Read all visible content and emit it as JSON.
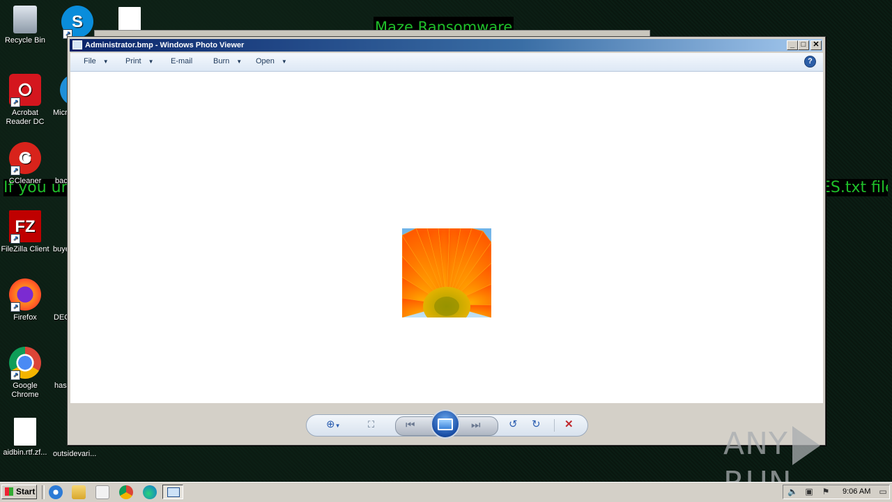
{
  "wallpaper": {
    "title_text": "Maze Ransomware",
    "line_left": "If you und",
    "line_right": "ES.txt file"
  },
  "desktop_icons": [
    {
      "label": "Recycle Bin",
      "icon": "recycle-bin-icon"
    },
    {
      "label": "Acrobat Reader DC",
      "icon": "acrobat-icon"
    },
    {
      "label": "CCleaner",
      "icon": "ccleaner-icon"
    },
    {
      "label": "FileZilla Client",
      "icon": "filezilla-icon"
    },
    {
      "label": "Firefox",
      "icon": "firefox-icon"
    },
    {
      "label": "Google Chrome",
      "icon": "chrome-icon"
    },
    {
      "label": "aidbin.rtf.zf...",
      "icon": "document-icon"
    },
    {
      "label": "",
      "icon": "skype-icon"
    },
    {
      "label": "Micr",
      "icon": "edge-icon"
    },
    {
      "label": "bac",
      "icon": "document-icon"
    },
    {
      "label": "buye",
      "icon": "document-icon"
    },
    {
      "label": "DEC",
      "icon": "document-icon"
    },
    {
      "label": "has",
      "icon": "document-icon"
    },
    {
      "label": "outsidevari...",
      "icon": "document-icon"
    }
  ],
  "window": {
    "title": "Administrator.bmp - Windows Photo Viewer",
    "menu": {
      "file": "File",
      "print": "Print",
      "email": "E-mail",
      "burn": "Burn",
      "open": "Open"
    }
  },
  "controls": {
    "zoom": "zoom-icon",
    "actual_size": "fit-window-icon",
    "previous": "previous-icon",
    "slideshow": "slideshow-icon",
    "next": "next-icon",
    "rotate_ccw": "rotate-counterclockwise-icon",
    "rotate_cw": "rotate-clockwise-icon",
    "delete": "delete-icon"
  },
  "watermark": {
    "left": "ANY",
    "right": "RUN"
  },
  "taskbar": {
    "start_label": "Start",
    "clock": "9:06 AM"
  },
  "colors": {
    "wallpaper_text": "#1fbf2a",
    "title_gradient_start": "#0a246a",
    "control_accent": "#2a5db0",
    "delete_red": "#c0282d"
  }
}
